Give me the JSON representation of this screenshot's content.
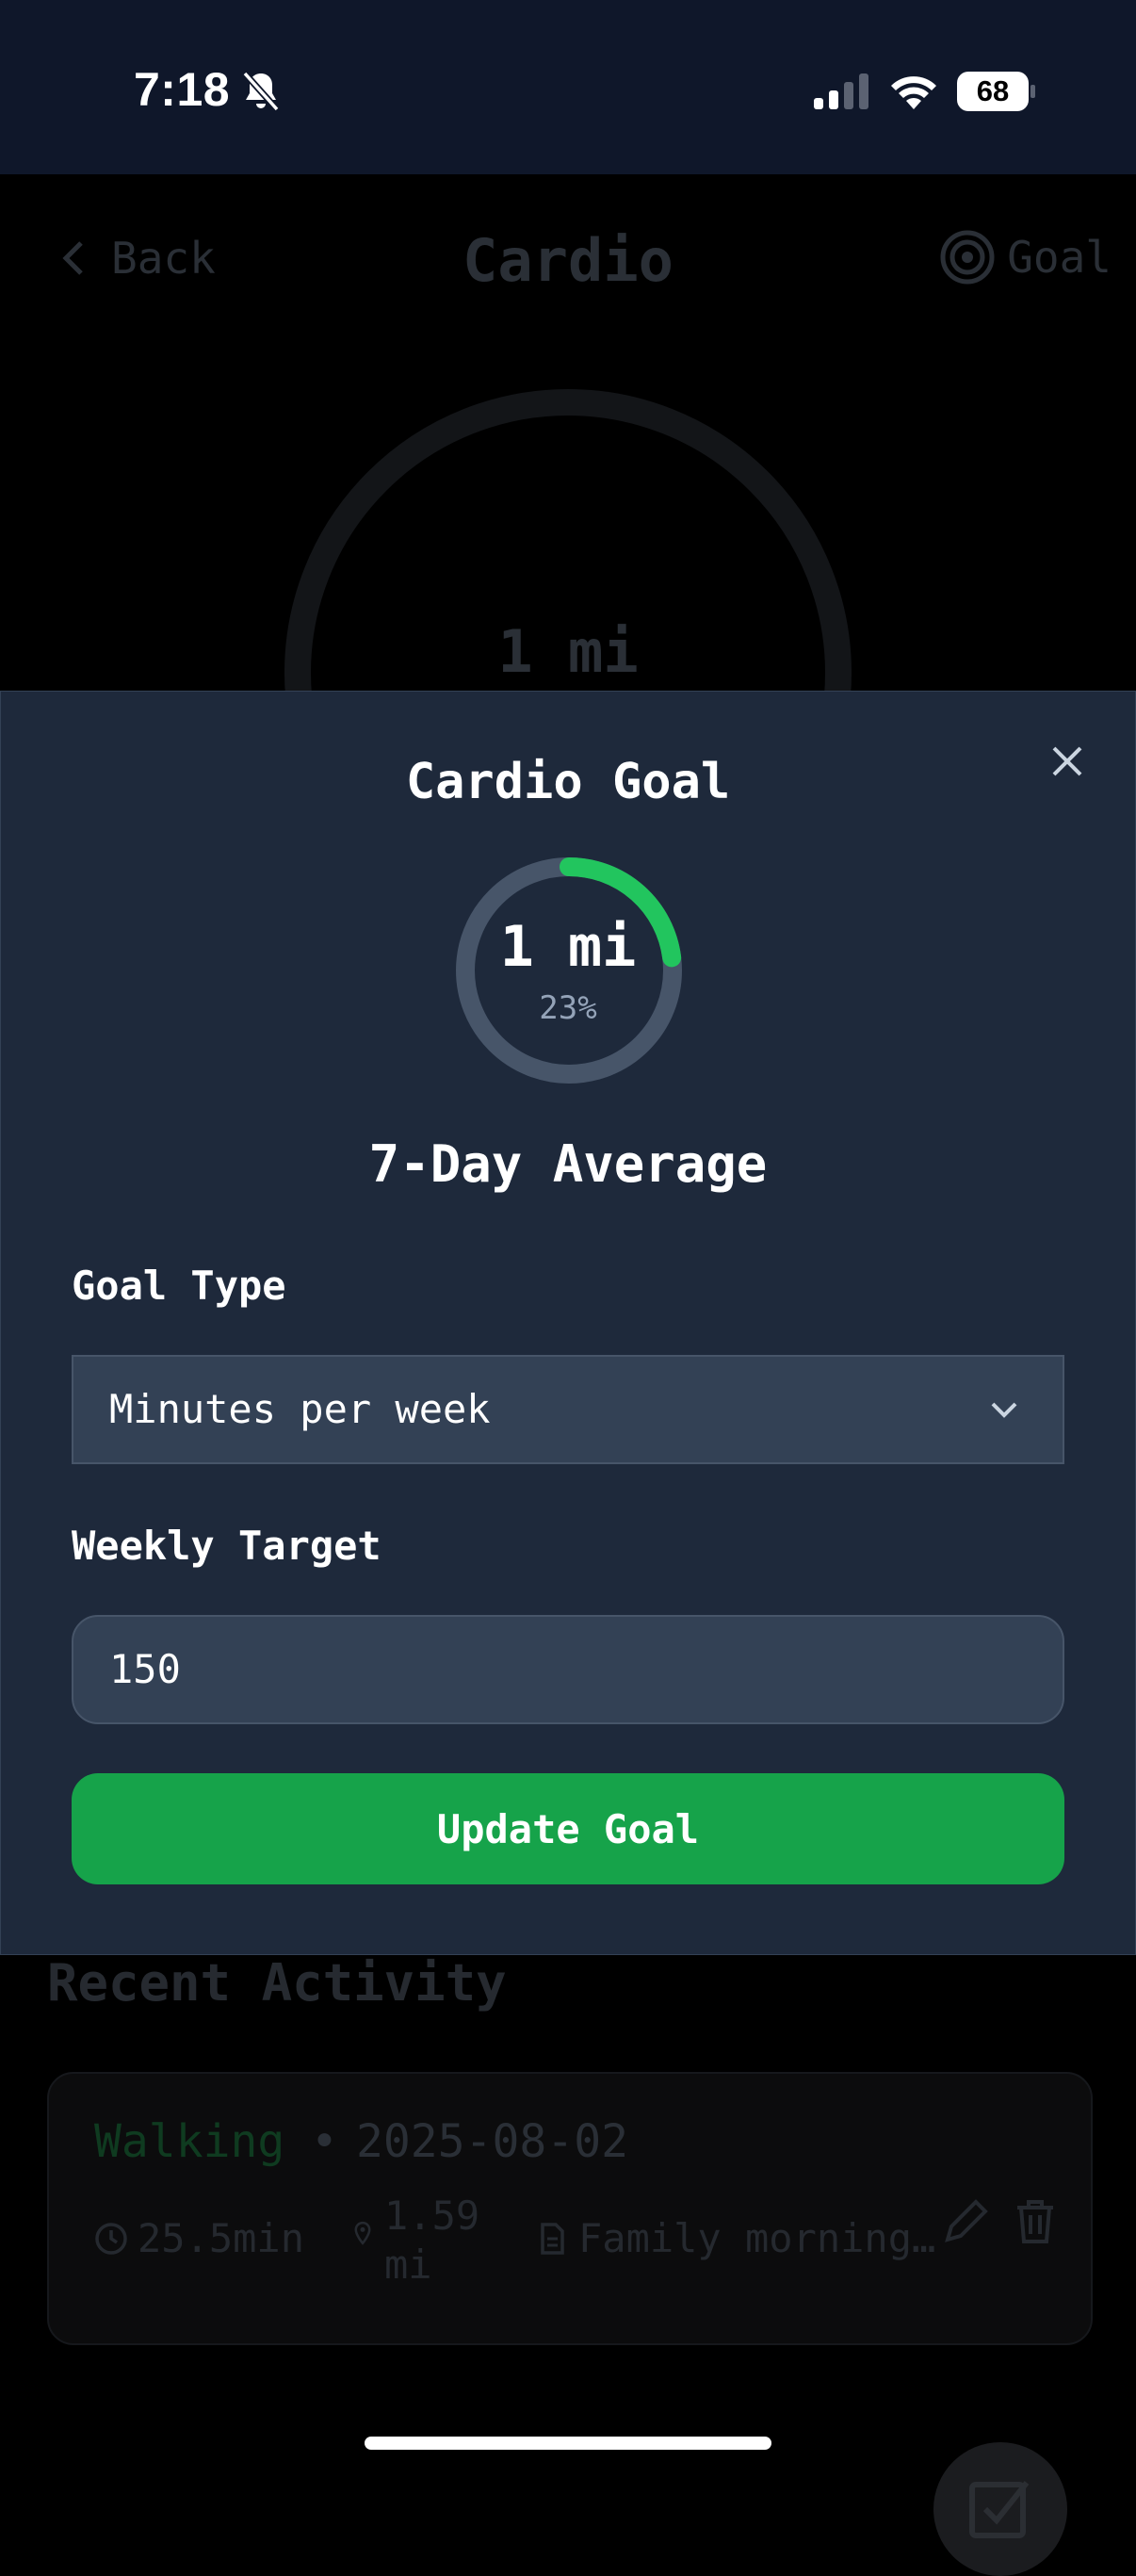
{
  "status_bar": {
    "time": "7:18",
    "battery": "68",
    "icons": [
      "bell-slash-icon",
      "signal-icon",
      "wifi-icon",
      "battery-icon"
    ]
  },
  "background": {
    "header": {
      "back_label": "Back",
      "title": "Cardio",
      "goal_label": "Goal"
    },
    "ring_value": "1 mi",
    "recent_title": "Recent Activity",
    "activity": {
      "name": "Walking",
      "separator": "•",
      "date": "2025-08-02",
      "duration": "25.5min",
      "distance_line1": "1.59",
      "distance_line2": "mi",
      "note": "Family morning…"
    }
  },
  "modal": {
    "title": "Cardio Goal",
    "progress": {
      "value": "1 mi",
      "percent": "23%",
      "fraction": 0.23
    },
    "average_label": "7-Day Average",
    "goal_type_label": "Goal Type",
    "goal_type_value": "Minutes per week",
    "weekly_target_label": "Weekly Target",
    "weekly_target_value": "150",
    "update_button": "Update Goal"
  },
  "colors": {
    "accent": "#22c55e",
    "button": "#16a34a",
    "modal_bg": "#1e293b",
    "field_bg": "#334155"
  }
}
